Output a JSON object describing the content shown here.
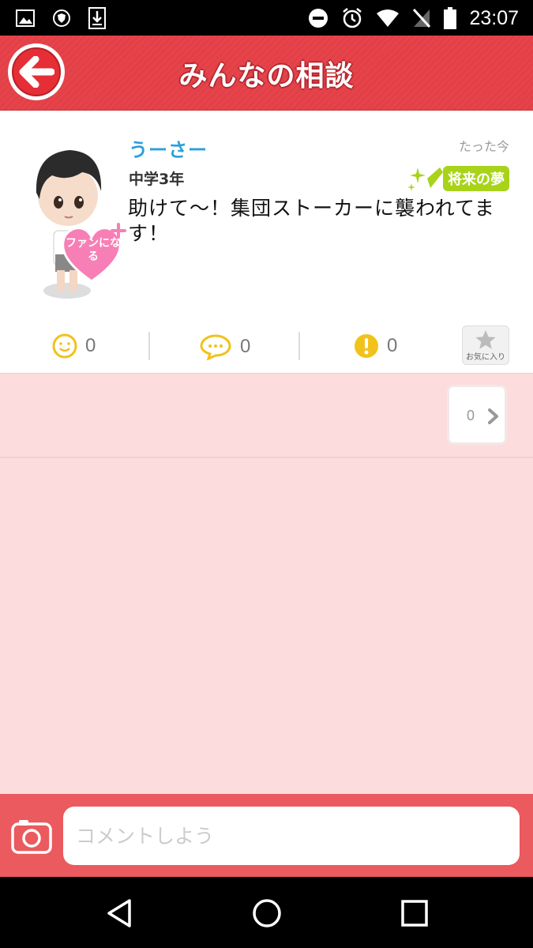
{
  "status_bar": {
    "time": "23:07"
  },
  "header": {
    "title": "みんなの相談"
  },
  "post": {
    "username": "うーさー",
    "grade": "中学3年",
    "time": "たった今",
    "tag": "将来の夢",
    "text": "助けて〜！集団ストーカーに襲われてます！",
    "fan_label": "ファンになる",
    "counts": {
      "smile": "0",
      "comment": "0",
      "alert": "0"
    },
    "favorite_label": "お気に入り"
  },
  "comment_count": "0",
  "input": {
    "placeholder": "コメントしよう"
  },
  "colors": {
    "header": "#e8434b",
    "background": "#fcdcdc",
    "accent_blue": "#2aa0dc",
    "tag_green": "#a8d31a"
  }
}
